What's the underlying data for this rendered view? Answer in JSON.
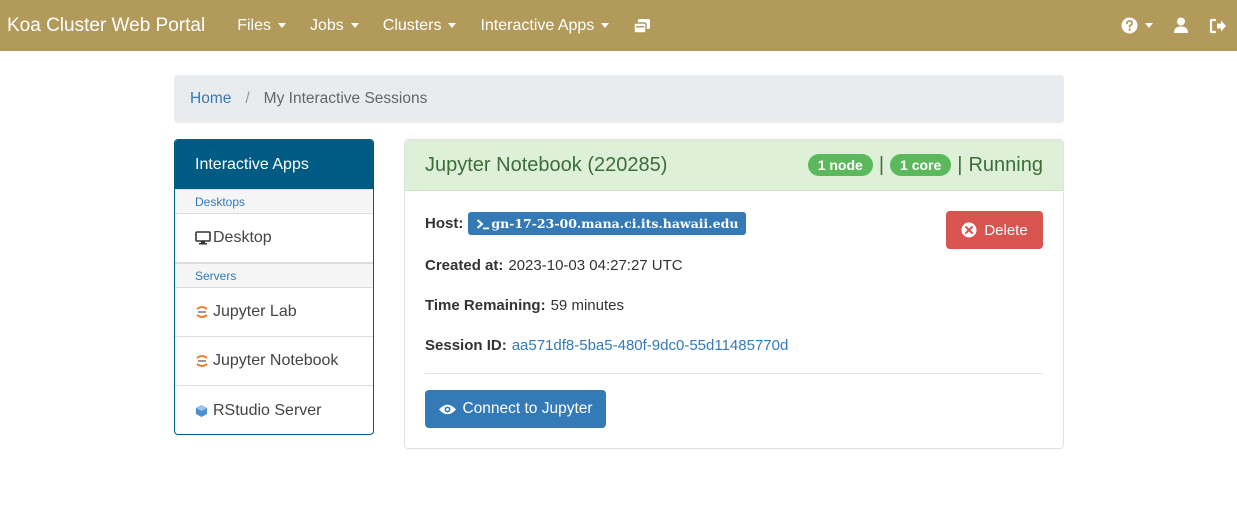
{
  "navbar": {
    "brand": "Koa Cluster Web Portal",
    "menus": [
      "Files",
      "Jobs",
      "Clusters",
      "Interactive Apps"
    ],
    "right_icons": [
      "help-icon",
      "user-icon",
      "logout-icon"
    ],
    "background": "#b29a5b"
  },
  "breadcrumb": {
    "home": "Home",
    "separator": "/",
    "current": "My Interactive Sessions"
  },
  "sidebar": {
    "title": "Interactive Apps",
    "sections": [
      {
        "label": "Desktops",
        "items": [
          {
            "label": "Desktop",
            "icon": "desktop-icon"
          }
        ]
      },
      {
        "label": "Servers",
        "items": [
          {
            "label": "Jupyter Lab",
            "icon": "jupyter-icon"
          },
          {
            "label": "Jupyter Notebook",
            "icon": "jupyter-icon"
          },
          {
            "label": "RStudio Server",
            "icon": "rstudio-icon"
          }
        ]
      }
    ]
  },
  "session": {
    "title": "Jupyter Notebook (220285)",
    "nodes": "1 node",
    "cores": "1 core",
    "separator": "|",
    "status": "Running",
    "host_label": "Host:",
    "host_value": "gn-17-23-00.mana.ci.its.hawaii.edu",
    "created_label": "Created at:",
    "created_value": "2023-10-03 04:27:27 UTC",
    "remaining_label": "Time Remaining:",
    "remaining_value": "59 minutes",
    "session_id_label": "Session ID:",
    "session_id_value": "aa571df8-5ba5-480f-9dc0-55d11485770d",
    "delete_label": "Delete",
    "connect_label": "Connect to Jupyter"
  },
  "colors": {
    "accent": "#337ab7",
    "sidebar_head": "#005b84",
    "success_bg": "#dff0d8",
    "badge": "#5cb85c",
    "danger": "#d9534f"
  }
}
